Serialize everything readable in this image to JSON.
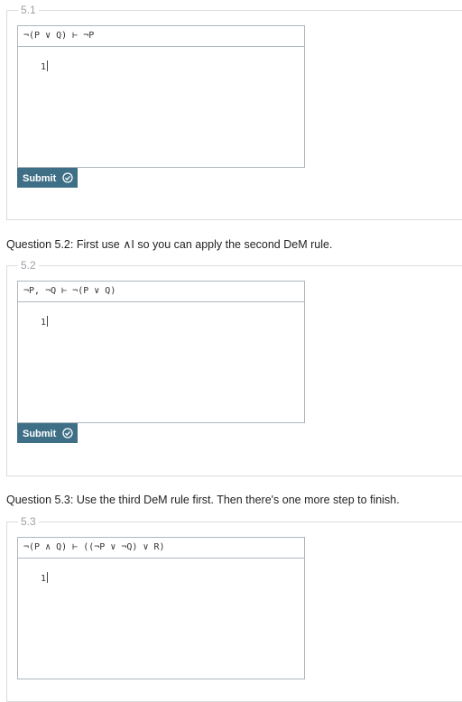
{
  "sections": [
    {
      "legend": "5.1",
      "sequent": "¬(P ∨ Q) ⊢ ¬P",
      "line_number": "1",
      "submit_label": "Submit"
    },
    {
      "question": "Question 5.2: First use ∧I so you can apply the second DeM rule.",
      "legend": "5.2",
      "sequent": "¬P, ¬Q ⊢ ¬(P ∨ Q)",
      "line_number": "1",
      "submit_label": "Submit"
    },
    {
      "question": "Question 5.3: Use the third DeM rule first. Then there's one more step to finish.",
      "legend": "5.3",
      "sequent": "¬(P ∧ Q) ⊢ ((¬P ∨ ¬Q) ∨ R)",
      "line_number": "1"
    }
  ],
  "icons": {
    "submit": "check-circle-icon"
  },
  "colors": {
    "submit_bg": "#3f6f87",
    "border": "#aeb7bd"
  }
}
